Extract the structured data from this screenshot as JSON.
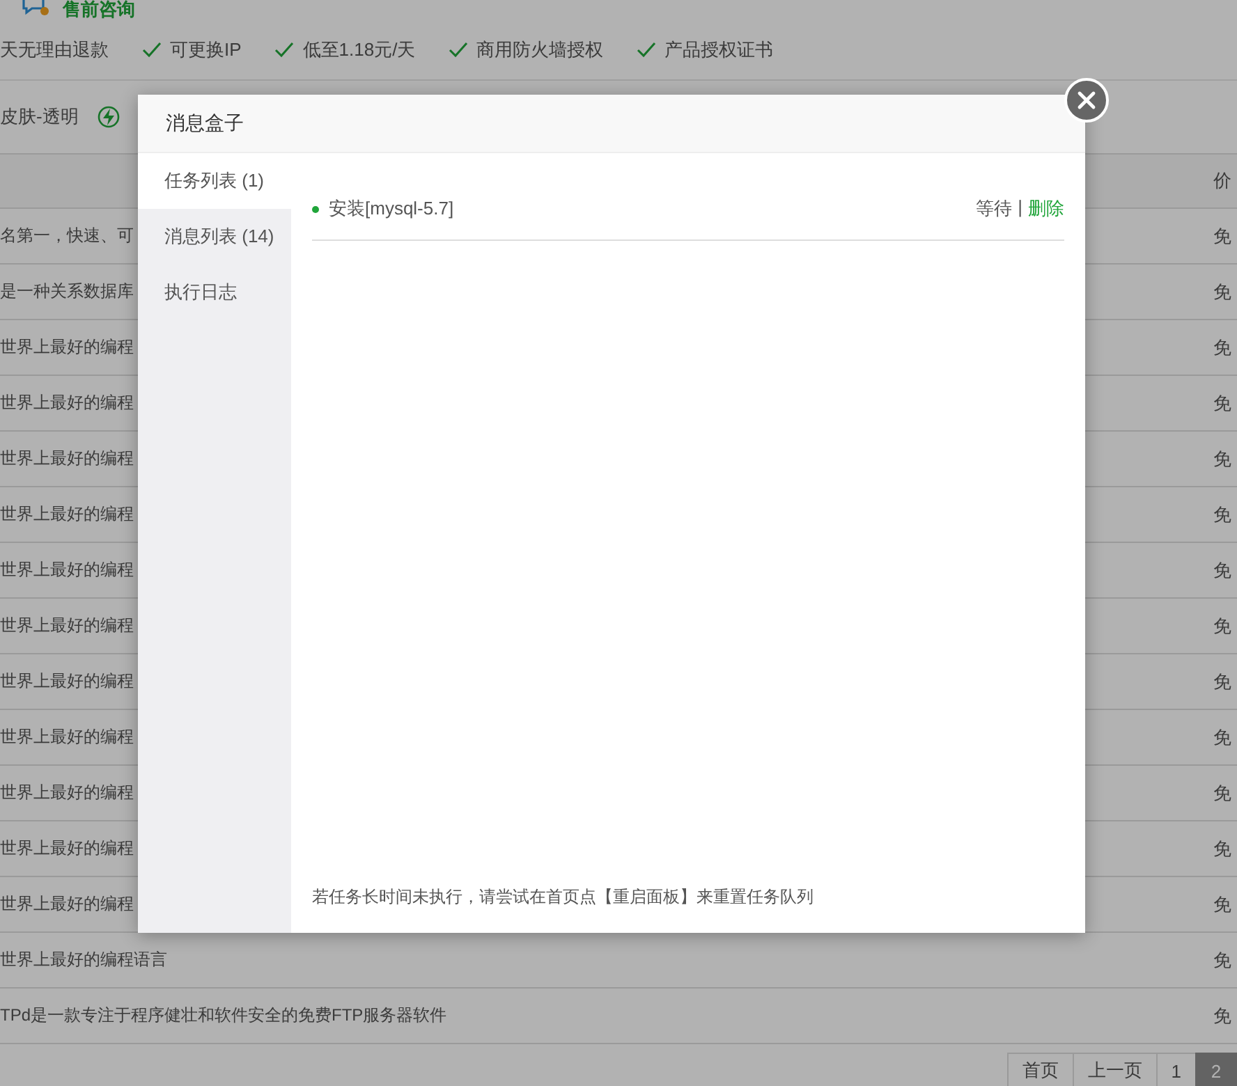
{
  "header": {
    "title": "售前咨询"
  },
  "features": [
    {
      "label": "天无理由退款",
      "checked": false
    },
    {
      "label": "可更换IP",
      "checked": true
    },
    {
      "label": "低至1.18元/天",
      "checked": true
    },
    {
      "label": "商用防火墙授权",
      "checked": true
    },
    {
      "label": "产品授权证书",
      "checked": true
    }
  ],
  "toolbar": {
    "skin_label": "皮肤-透明"
  },
  "table": {
    "columns": [
      "价"
    ],
    "rows": [
      {
        "column_1": "名第一，快速、可",
        "column_2": "免"
      },
      {
        "column_1": "是一种关系数据库",
        "column_2": "免"
      },
      {
        "column_1": "世界上最好的编程",
        "column_2": "免"
      },
      {
        "column_1": "世界上最好的编程",
        "column_2": "免"
      },
      {
        "column_1": "世界上最好的编程",
        "column_2": "免"
      },
      {
        "column_1": "世界上最好的编程",
        "column_2": "免"
      },
      {
        "column_1": "世界上最好的编程",
        "column_2": "免"
      },
      {
        "column_1": "世界上最好的编程",
        "column_2": "免"
      },
      {
        "column_1": "世界上最好的编程",
        "column_2": "免"
      },
      {
        "column_1": "世界上最好的编程",
        "column_2": "免"
      },
      {
        "column_1": "世界上最好的编程",
        "column_2": "免"
      },
      {
        "column_1": "世界上最好的编程",
        "column_2": "免"
      },
      {
        "column_1": "世界上最好的编程",
        "column_2": "免"
      },
      {
        "column_1": "世界上最好的编程语言",
        "column_2": "免"
      },
      {
        "column_1": "TPd是一款专注于程序健壮和软件安全的免费FTP服务器软件",
        "column_2": "免"
      }
    ]
  },
  "pagination": [
    {
      "label": "首页",
      "selected": false
    },
    {
      "label": "上一页",
      "selected": false
    },
    {
      "label": "1",
      "selected": false
    },
    {
      "label": "2",
      "selected": true
    }
  ],
  "dialog": {
    "title": "消息盒子",
    "tabs": [
      {
        "label": "任务列表 (1)",
        "selected": true
      },
      {
        "label": "消息列表 (14)",
        "selected": false
      },
      {
        "label": "执行日志",
        "selected": false
      }
    ],
    "tasks": [
      {
        "name": "安装[mysql-5.7]",
        "status": "等待",
        "separator": "|",
        "action": "删除"
      }
    ],
    "note": "若任务长时间未执行，请尝试在首页点【重启面板】来重置任务队列"
  }
}
